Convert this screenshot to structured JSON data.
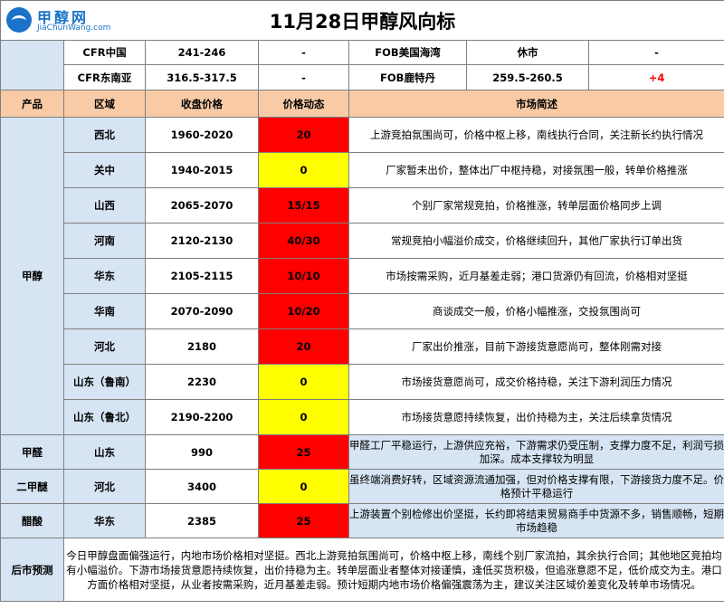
{
  "title": "11月28日甲醇风向标",
  "logo": {
    "cn": "甲醇网",
    "en": "JiaChunWang.com"
  },
  "colors": {
    "header_bg": "#f8cba6",
    "label_bg": "#d6e4f3",
    "up": "#ff0000",
    "flat": "#ffff00"
  },
  "intl": [
    {
      "a_name": "CFR中国",
      "a_price": "241-246",
      "a_change": "-",
      "b_name": "FOB美国海湾",
      "b_price": "休市",
      "b_change": "-"
    },
    {
      "a_name": "CFR东南亚",
      "a_price": "316.5-317.5",
      "a_change": "-",
      "b_name": "FOB鹿特丹",
      "b_price": "259.5-260.5",
      "b_change": "+4"
    }
  ],
  "headers": {
    "product": "产品",
    "region": "区域",
    "price": "收盘价格",
    "change": "价格动态",
    "desc": "市场简述"
  },
  "methanol": {
    "product": "甲醇",
    "rows": [
      {
        "region": "西北",
        "price": "1960-2020",
        "change": "20",
        "desc": "上游竞拍氛围尚可，价格中枢上移，南线执行合同，关注新长约执行情况"
      },
      {
        "region": "关中",
        "price": "1940-2015",
        "change": "0",
        "desc": "厂家暂未出价，整体出厂中枢持稳，对接氛围一般，转单价格推涨"
      },
      {
        "region": "山西",
        "price": "2065-2070",
        "change": "15/15",
        "desc": "个别厂家常规竞拍，价格推涨，转单层面价格同步上调"
      },
      {
        "region": "河南",
        "price": "2120-2130",
        "change": "40/30",
        "desc": "常规竞拍小幅溢价成交，价格继续回升，其他厂家执行订单出货"
      },
      {
        "region": "华东",
        "price": "2105-2115",
        "change": "10/10",
        "desc": "市场按需采购，近月基差走弱；港口货源仍有回流，价格相对坚挺"
      },
      {
        "region": "华南",
        "price": "2070-2090",
        "change": "10/20",
        "desc": "商谈成交一般，价格小幅推涨，交投氛围尚可"
      },
      {
        "region": "河北",
        "price": "2180",
        "change": "20",
        "desc": "厂家出价推涨，目前下游接货意愿尚可，整体刚需对接"
      },
      {
        "region": "山东（鲁南）",
        "price": "2230",
        "change": "0",
        "desc": "市场接货意愿尚可，成交价格持稳，关注下游利润压力情况"
      },
      {
        "region": "山东（鲁北）",
        "price": "2190-2200",
        "change": "0",
        "desc": "市场接货意愿持续恢复，出价持稳为主，关注后续拿货情况"
      }
    ]
  },
  "others": [
    {
      "product": "甲醛",
      "region": "山东",
      "price": "990",
      "change": "25",
      "desc": "甲醛工厂平稳运行，上游供应充裕，下游需求仍受压制，支撑力度不足，利润亏损加深。成本支撑较为明显"
    },
    {
      "product": "二甲醚",
      "region": "河北",
      "price": "3400",
      "change": "0",
      "desc": "虽终端消费好转，区域资源流通加强，但对价格支撑有限，下游接货力度不足。价格预计平稳运行"
    },
    {
      "product": "醋酸",
      "region": "华东",
      "price": "2385",
      "change": "25",
      "desc": "上游装置个别检修出价坚挺，长约即将结束贸易商手中货源不多，销售顺畅，短期市场趋稳"
    }
  ],
  "outlook": {
    "label": "后市预测",
    "text": "今日甲醇盘面偏强运行，内地市场价格相对坚挺。西北上游竞拍氛围尚可，价格中枢上移，南线个别厂家流拍，其余执行合同；其他地区竞拍均有小幅溢价。下游市场接货意愿持续恢复，出价持稳为主。转单层面业者整体对接谨慎，逢低买货积极，但追涨意愿不足，低价成交为主。港口方面价格相对坚挺，从业者按需采购，近月基差走弱。预计短期内地市场价格偏强震荡为主，建议关注区域价差变化及转单市场情况。"
  }
}
